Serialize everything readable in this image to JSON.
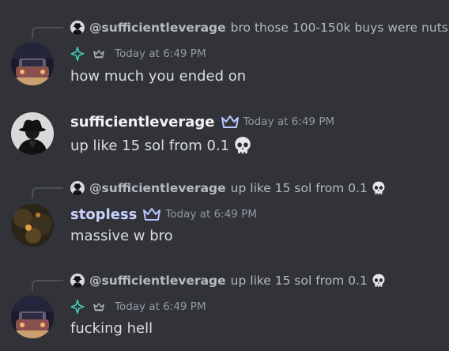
{
  "colors": {
    "background": "#313338",
    "text": "#dbdee1",
    "muted": "#949ba4",
    "sparkle": "#3fd0b4",
    "crown": "#b9c6ff"
  },
  "messages": [
    {
      "reply": {
        "author": "@sufficientleverage",
        "text": "bro those 100-150k buys were nuts",
        "skull": false
      },
      "author": "",
      "badges": [
        "sparkle-icon",
        "crown-icon"
      ],
      "timestamp": "Today at 6:49 PM",
      "content": "how much you ended on",
      "content_skull": false
    },
    {
      "reply": null,
      "author": "sufficientleverage",
      "badges": [
        "crown-icon"
      ],
      "timestamp": "Today at 6:49 PM",
      "content": "up like 15 sol from 0.1",
      "content_skull": true
    },
    {
      "reply": {
        "author": "@sufficientleverage",
        "text": "up like 15 sol from 0.1",
        "skull": true
      },
      "author": "stopless",
      "badges": [
        "crown-icon"
      ],
      "timestamp": "Today at 6:49 PM",
      "content": "massive w bro",
      "content_skull": false
    },
    {
      "reply": {
        "author": "@sufficientleverage",
        "text": "up like 15 sol from 0.1",
        "skull": true
      },
      "author": "",
      "badges": [
        "sparkle-icon",
        "crown-icon"
      ],
      "timestamp": "Today at 6:49 PM",
      "content": "fucking hell",
      "content_skull": false
    }
  ]
}
